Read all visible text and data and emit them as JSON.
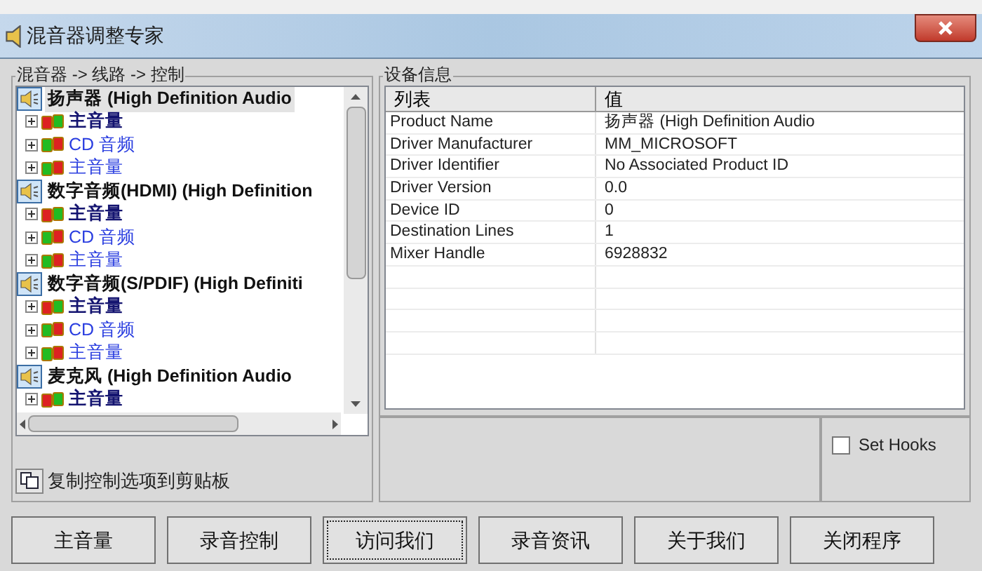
{
  "window": {
    "title": "混音器调整专家"
  },
  "tree": {
    "title": "混音器 -> 线路 -> 控制",
    "groups": [
      {
        "label": "扬声器 (High Definition Audio",
        "selected": true,
        "children": [
          {
            "label": "主音量",
            "kind": "master"
          },
          {
            "label": "CD 音频",
            "kind": "line"
          },
          {
            "label": "主音量",
            "kind": "line"
          }
        ]
      },
      {
        "label": "数字音频(HDMI) (High Definition",
        "selected": false,
        "children": [
          {
            "label": "主音量",
            "kind": "master"
          },
          {
            "label": "CD 音频",
            "kind": "line"
          },
          {
            "label": "主音量",
            "kind": "line"
          }
        ]
      },
      {
        "label": "数字音频(S/PDIF) (High Definiti",
        "selected": false,
        "children": [
          {
            "label": "主音量",
            "kind": "master"
          },
          {
            "label": "CD 音频",
            "kind": "line"
          },
          {
            "label": "主音量",
            "kind": "line"
          }
        ]
      },
      {
        "label": "麦克风 (High Definition Audio",
        "selected": false,
        "children": [
          {
            "label": "主音量",
            "kind": "master"
          }
        ]
      }
    ]
  },
  "copy_button": {
    "label": "复制控制选项到剪贴板"
  },
  "device_info": {
    "title": "设备信息",
    "columns": [
      "列表",
      "值"
    ],
    "rows": [
      [
        "Product Name",
        "扬声器 (High Definition Audio"
      ],
      [
        "Driver Manufacturer",
        "MM_MICROSOFT"
      ],
      [
        "Driver Identifier",
        "No Associated Product ID"
      ],
      [
        "Driver Version",
        "0.0"
      ],
      [
        "Device ID",
        "0"
      ],
      [
        "Destination Lines",
        "1"
      ],
      [
        "Mixer Handle",
        "6928832"
      ]
    ]
  },
  "set_hooks": {
    "label": "Set Hooks",
    "checked": false
  },
  "buttons": [
    {
      "label": "主音量",
      "focused": false
    },
    {
      "label": "录音控制",
      "focused": false
    },
    {
      "label": "访问我们",
      "focused": true
    },
    {
      "label": "录音资讯",
      "focused": false
    },
    {
      "label": "关于我们",
      "focused": false
    },
    {
      "label": "关闭程序",
      "focused": false
    }
  ]
}
